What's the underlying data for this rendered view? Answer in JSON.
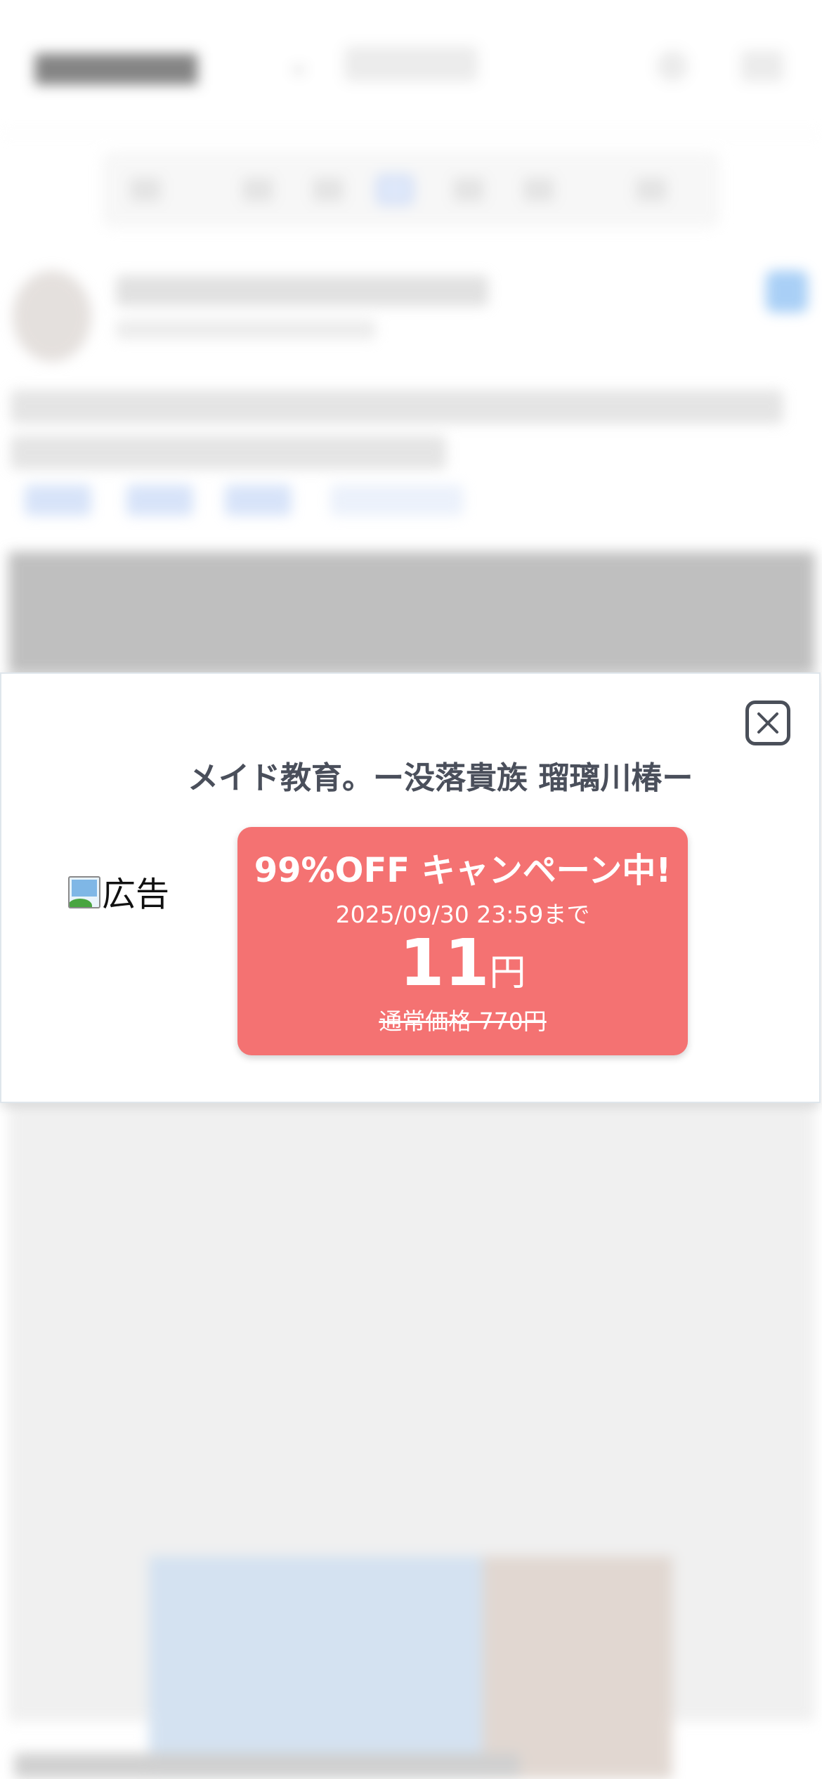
{
  "background": {
    "note_blurred": true
  },
  "popup": {
    "title": "メイド教育。ー没落貴族 瑠璃川椿ー",
    "ad_image_alt": "広告",
    "close_icon": "close-icon",
    "promo": {
      "headline": "99%OFF キャンペーン中!",
      "deadline": "2025/09/30 23:59まで",
      "price": "11",
      "price_unit": "円",
      "regular_price": "通常価格 770円",
      "bg_color": "#f47272"
    }
  }
}
